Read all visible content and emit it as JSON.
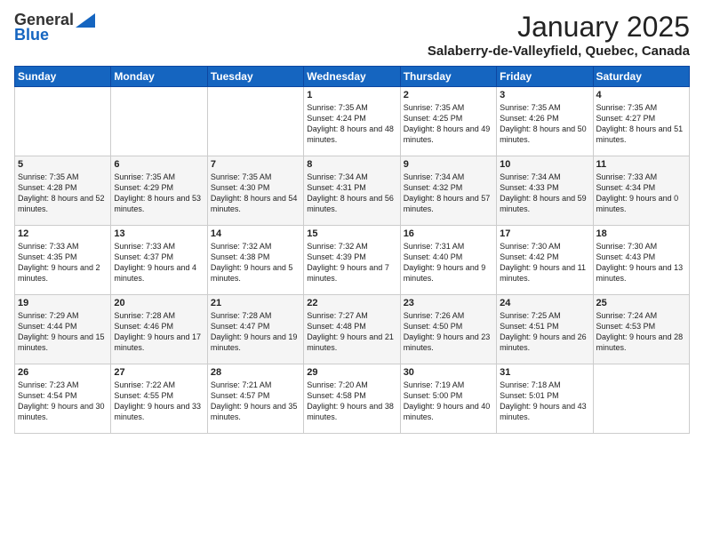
{
  "logo": {
    "general": "General",
    "blue": "Blue"
  },
  "header": {
    "month": "January 2025",
    "location": "Salaberry-de-Valleyfield, Quebec, Canada"
  },
  "days_of_week": [
    "Sunday",
    "Monday",
    "Tuesday",
    "Wednesday",
    "Thursday",
    "Friday",
    "Saturday"
  ],
  "weeks": [
    [
      {
        "day": "",
        "content": ""
      },
      {
        "day": "",
        "content": ""
      },
      {
        "day": "",
        "content": ""
      },
      {
        "day": "1",
        "content": "Sunrise: 7:35 AM\nSunset: 4:24 PM\nDaylight: 8 hours and 48 minutes."
      },
      {
        "day": "2",
        "content": "Sunrise: 7:35 AM\nSunset: 4:25 PM\nDaylight: 8 hours and 49 minutes."
      },
      {
        "day": "3",
        "content": "Sunrise: 7:35 AM\nSunset: 4:26 PM\nDaylight: 8 hours and 50 minutes."
      },
      {
        "day": "4",
        "content": "Sunrise: 7:35 AM\nSunset: 4:27 PM\nDaylight: 8 hours and 51 minutes."
      }
    ],
    [
      {
        "day": "5",
        "content": "Sunrise: 7:35 AM\nSunset: 4:28 PM\nDaylight: 8 hours and 52 minutes."
      },
      {
        "day": "6",
        "content": "Sunrise: 7:35 AM\nSunset: 4:29 PM\nDaylight: 8 hours and 53 minutes."
      },
      {
        "day": "7",
        "content": "Sunrise: 7:35 AM\nSunset: 4:30 PM\nDaylight: 8 hours and 54 minutes."
      },
      {
        "day": "8",
        "content": "Sunrise: 7:34 AM\nSunset: 4:31 PM\nDaylight: 8 hours and 56 minutes."
      },
      {
        "day": "9",
        "content": "Sunrise: 7:34 AM\nSunset: 4:32 PM\nDaylight: 8 hours and 57 minutes."
      },
      {
        "day": "10",
        "content": "Sunrise: 7:34 AM\nSunset: 4:33 PM\nDaylight: 8 hours and 59 minutes."
      },
      {
        "day": "11",
        "content": "Sunrise: 7:33 AM\nSunset: 4:34 PM\nDaylight: 9 hours and 0 minutes."
      }
    ],
    [
      {
        "day": "12",
        "content": "Sunrise: 7:33 AM\nSunset: 4:35 PM\nDaylight: 9 hours and 2 minutes."
      },
      {
        "day": "13",
        "content": "Sunrise: 7:33 AM\nSunset: 4:37 PM\nDaylight: 9 hours and 4 minutes."
      },
      {
        "day": "14",
        "content": "Sunrise: 7:32 AM\nSunset: 4:38 PM\nDaylight: 9 hours and 5 minutes."
      },
      {
        "day": "15",
        "content": "Sunrise: 7:32 AM\nSunset: 4:39 PM\nDaylight: 9 hours and 7 minutes."
      },
      {
        "day": "16",
        "content": "Sunrise: 7:31 AM\nSunset: 4:40 PM\nDaylight: 9 hours and 9 minutes."
      },
      {
        "day": "17",
        "content": "Sunrise: 7:30 AM\nSunset: 4:42 PM\nDaylight: 9 hours and 11 minutes."
      },
      {
        "day": "18",
        "content": "Sunrise: 7:30 AM\nSunset: 4:43 PM\nDaylight: 9 hours and 13 minutes."
      }
    ],
    [
      {
        "day": "19",
        "content": "Sunrise: 7:29 AM\nSunset: 4:44 PM\nDaylight: 9 hours and 15 minutes."
      },
      {
        "day": "20",
        "content": "Sunrise: 7:28 AM\nSunset: 4:46 PM\nDaylight: 9 hours and 17 minutes."
      },
      {
        "day": "21",
        "content": "Sunrise: 7:28 AM\nSunset: 4:47 PM\nDaylight: 9 hours and 19 minutes."
      },
      {
        "day": "22",
        "content": "Sunrise: 7:27 AM\nSunset: 4:48 PM\nDaylight: 9 hours and 21 minutes."
      },
      {
        "day": "23",
        "content": "Sunrise: 7:26 AM\nSunset: 4:50 PM\nDaylight: 9 hours and 23 minutes."
      },
      {
        "day": "24",
        "content": "Sunrise: 7:25 AM\nSunset: 4:51 PM\nDaylight: 9 hours and 26 minutes."
      },
      {
        "day": "25",
        "content": "Sunrise: 7:24 AM\nSunset: 4:53 PM\nDaylight: 9 hours and 28 minutes."
      }
    ],
    [
      {
        "day": "26",
        "content": "Sunrise: 7:23 AM\nSunset: 4:54 PM\nDaylight: 9 hours and 30 minutes."
      },
      {
        "day": "27",
        "content": "Sunrise: 7:22 AM\nSunset: 4:55 PM\nDaylight: 9 hours and 33 minutes."
      },
      {
        "day": "28",
        "content": "Sunrise: 7:21 AM\nSunset: 4:57 PM\nDaylight: 9 hours and 35 minutes."
      },
      {
        "day": "29",
        "content": "Sunrise: 7:20 AM\nSunset: 4:58 PM\nDaylight: 9 hours and 38 minutes."
      },
      {
        "day": "30",
        "content": "Sunrise: 7:19 AM\nSunset: 5:00 PM\nDaylight: 9 hours and 40 minutes."
      },
      {
        "day": "31",
        "content": "Sunrise: 7:18 AM\nSunset: 5:01 PM\nDaylight: 9 hours and 43 minutes."
      },
      {
        "day": "",
        "content": ""
      }
    ]
  ]
}
